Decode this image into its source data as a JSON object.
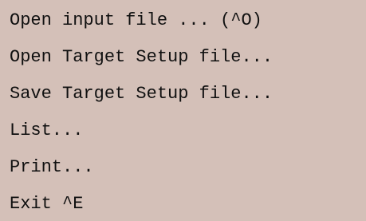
{
  "menu": {
    "items": [
      {
        "label": "Open input file ... (^O)"
      },
      {
        "label": "Open Target Setup file..."
      },
      {
        "label": "Save Target Setup file..."
      },
      {
        "label": "List..."
      },
      {
        "label": "Print..."
      },
      {
        "label": "Exit ^E"
      }
    ]
  },
  "colors": {
    "menu_background": "#d4c0b8",
    "text": "#101010"
  }
}
